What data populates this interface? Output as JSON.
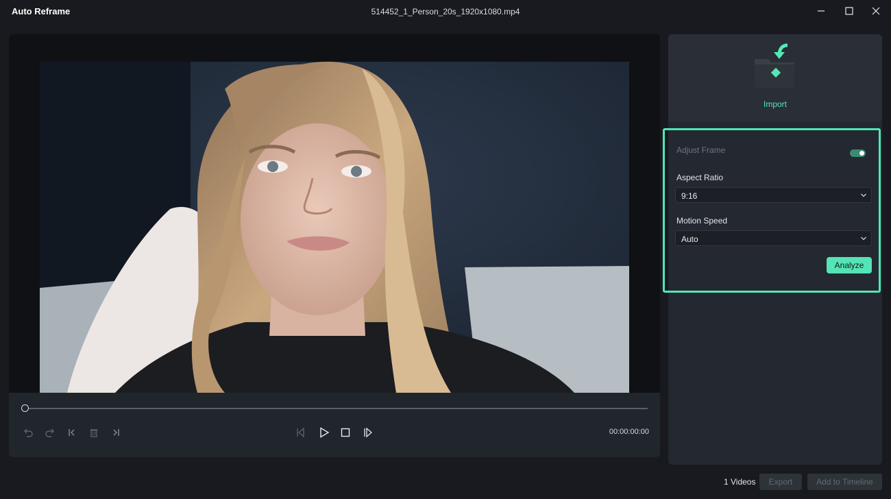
{
  "window": {
    "app_title": "Auto Reframe",
    "file_name": "514452_1_Person_20s_1920x1080.mp4",
    "controls": [
      "minimize-icon",
      "maximize-icon",
      "close-icon"
    ]
  },
  "player": {
    "timecode": "00:00:00:00",
    "progress": 0,
    "controls": [
      "undo-icon",
      "redo-icon",
      "mark-in-icon",
      "delete-icon",
      "mark-out-icon",
      "previous-frame-icon",
      "play-icon",
      "stop-icon",
      "next-frame-icon"
    ]
  },
  "import": {
    "label": "Import",
    "icon": "import-folder-icon"
  },
  "settings": {
    "adjust_frame_label": "Adjust Frame",
    "adjust_frame_enabled": true,
    "aspect_ratio_label": "Aspect Ratio",
    "aspect_ratio_value": "9:16",
    "motion_speed_label": "Motion Speed",
    "motion_speed_value": "Auto",
    "analyze_label": "Analyze"
  },
  "footer": {
    "video_count": "1 Videos",
    "export_label": "Export",
    "add_to_timeline_label": "Add to Timeline"
  },
  "colors": {
    "accent": "#54e4b6",
    "background": "#181a1f",
    "panel": "#242830"
  }
}
